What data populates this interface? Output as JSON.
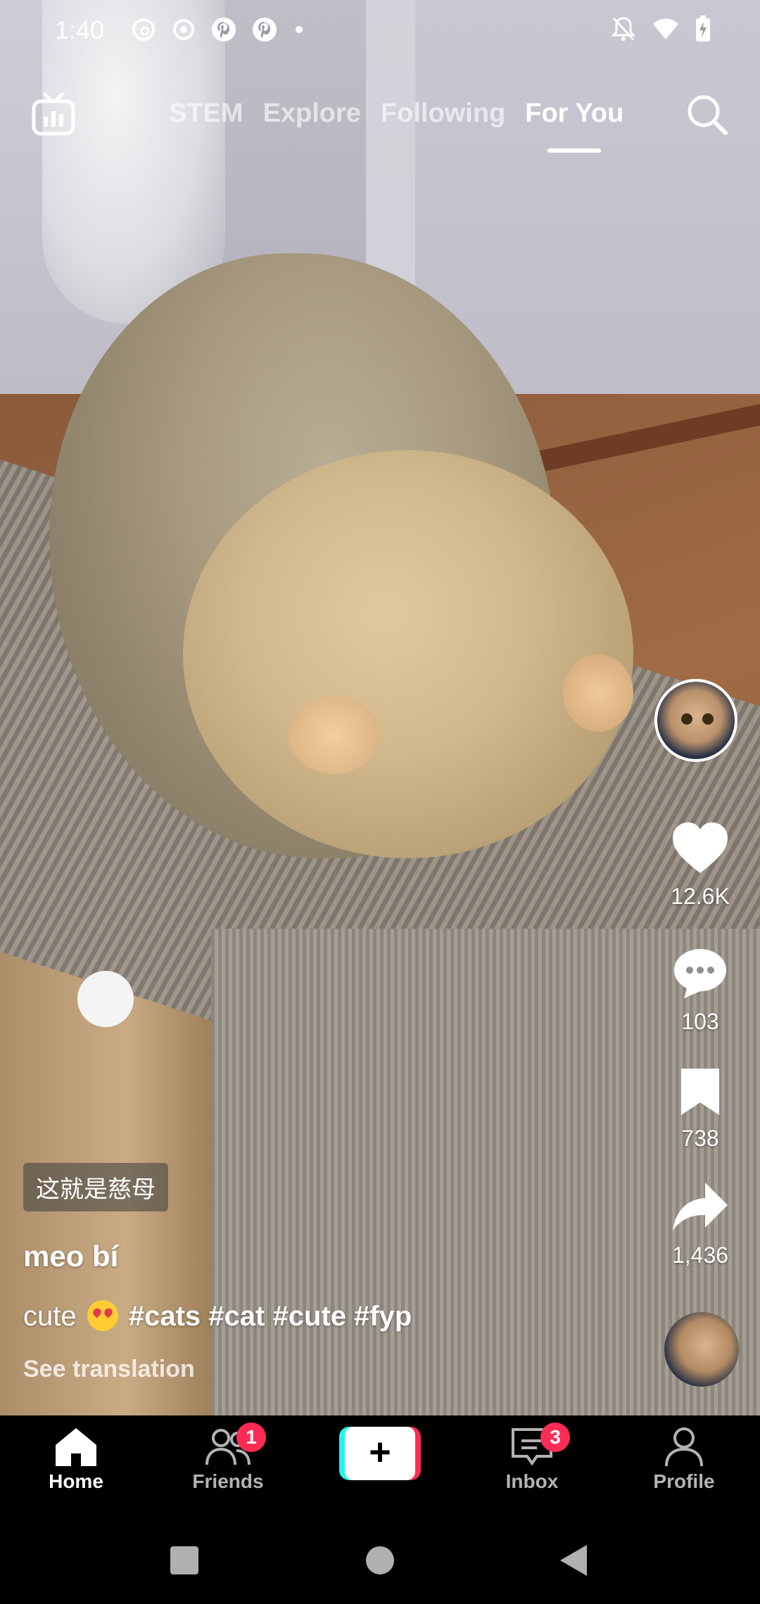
{
  "status_bar": {
    "time": "1:40",
    "left_icons": [
      "threads-icon",
      "record-icon",
      "pinterest-icon",
      "pinterest-icon",
      "dot-icon"
    ],
    "right_icons": [
      "bell-off-icon",
      "wifi-icon",
      "battery-charging-icon"
    ]
  },
  "top_nav": {
    "live_icon": "live-tv-icon",
    "tabs": [
      {
        "label": "STEM",
        "active": false
      },
      {
        "label": "Explore",
        "active": false
      },
      {
        "label": "Following",
        "active": false
      },
      {
        "label": "For You",
        "active": true
      }
    ],
    "search_icon": "search-icon"
  },
  "rail": {
    "like_count": "12.6K",
    "comment_count": "103",
    "bookmark_count": "738",
    "share_count": "1,436"
  },
  "post": {
    "subtitle": "这就是慈母",
    "username": "meo bí",
    "desc_prefix": "cute",
    "hashtags": "#cats #cat #cute #fyp",
    "see_translation": "See translation"
  },
  "bottom_nav": {
    "home": "Home",
    "friends": "Friends",
    "friends_badge": "1",
    "inbox": "Inbox",
    "inbox_badge": "3",
    "profile": "Profile",
    "create_symbol": "+"
  },
  "colors": {
    "accent_red": "#fe2c55",
    "accent_cyan": "#25f4ee"
  }
}
